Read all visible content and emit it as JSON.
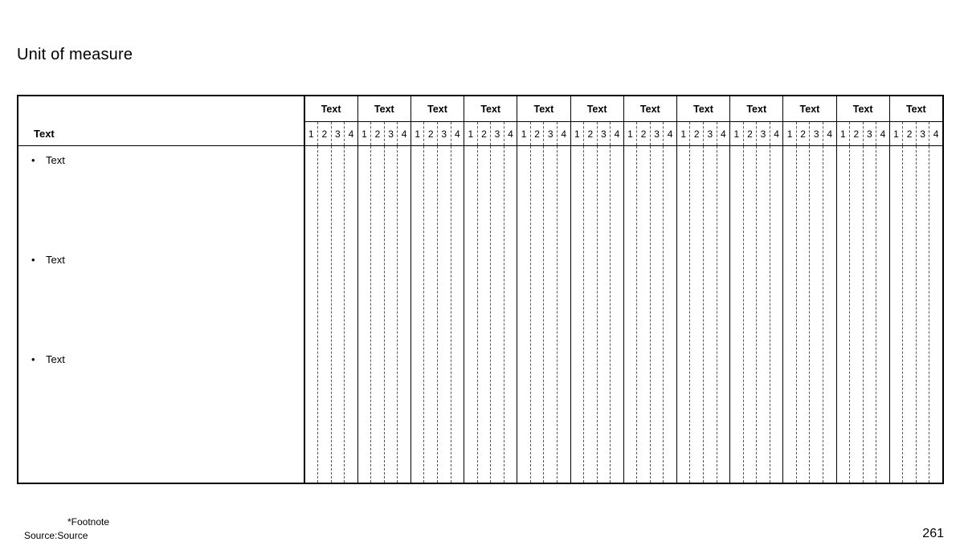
{
  "slide": {
    "title": "Unit of measure"
  },
  "table": {
    "stub_header_label": "Text",
    "bullets": [
      {
        "marker": "•",
        "label": "Text"
      },
      {
        "marker": "•",
        "label": "Text"
      },
      {
        "marker": "•",
        "label": "Text"
      }
    ],
    "bullet_tops": [
      10,
      134,
      258
    ],
    "column_groups": [
      {
        "title": "Text",
        "subcolumns": [
          "1",
          "2",
          "3",
          "4"
        ]
      },
      {
        "title": "Text",
        "subcolumns": [
          "1",
          "2",
          "3",
          "4"
        ]
      },
      {
        "title": "Text",
        "subcolumns": [
          "1",
          "2",
          "3",
          "4"
        ]
      },
      {
        "title": "Text",
        "subcolumns": [
          "1",
          "2",
          "3",
          "4"
        ]
      },
      {
        "title": "Text",
        "subcolumns": [
          "1",
          "2",
          "3",
          "4"
        ]
      },
      {
        "title": "Text",
        "subcolumns": [
          "1",
          "2",
          "3",
          "4"
        ]
      },
      {
        "title": "Text",
        "subcolumns": [
          "1",
          "2",
          "3",
          "4"
        ]
      },
      {
        "title": "Text",
        "subcolumns": [
          "1",
          "2",
          "3",
          "4"
        ]
      },
      {
        "title": "Text",
        "subcolumns": [
          "1",
          "2",
          "3",
          "4"
        ]
      },
      {
        "title": "Text",
        "subcolumns": [
          "1",
          "2",
          "3",
          "4"
        ]
      },
      {
        "title": "Text",
        "subcolumns": [
          "1",
          "2",
          "3",
          "4"
        ]
      },
      {
        "title": "Text",
        "subcolumns": [
          "1",
          "2",
          "3",
          "4"
        ]
      }
    ]
  },
  "footer": {
    "footnote": "*Footnote",
    "source": "Source:Source",
    "page_number": "261"
  },
  "colors": {
    "text": "#000000",
    "background": "#ffffff",
    "rule": "#000000",
    "dashed_guide": "#555555"
  }
}
